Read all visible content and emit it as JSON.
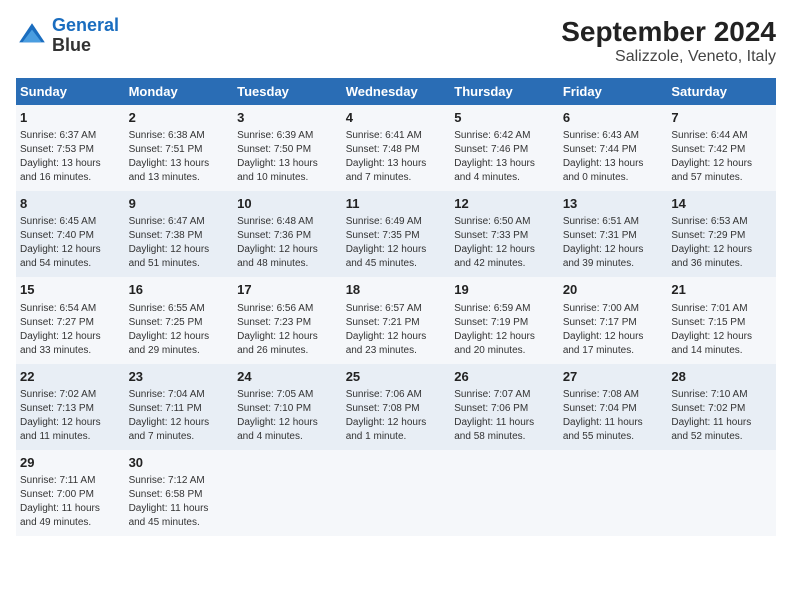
{
  "header": {
    "logo_line1": "General",
    "logo_line2": "Blue",
    "title": "September 2024",
    "subtitle": "Salizzole, Veneto, Italy"
  },
  "days_of_week": [
    "Sunday",
    "Monday",
    "Tuesday",
    "Wednesday",
    "Thursday",
    "Friday",
    "Saturday"
  ],
  "weeks": [
    [
      {
        "day": "1",
        "detail": "Sunrise: 6:37 AM\nSunset: 7:53 PM\nDaylight: 13 hours\nand 16 minutes."
      },
      {
        "day": "2",
        "detail": "Sunrise: 6:38 AM\nSunset: 7:51 PM\nDaylight: 13 hours\nand 13 minutes."
      },
      {
        "day": "3",
        "detail": "Sunrise: 6:39 AM\nSunset: 7:50 PM\nDaylight: 13 hours\nand 10 minutes."
      },
      {
        "day": "4",
        "detail": "Sunrise: 6:41 AM\nSunset: 7:48 PM\nDaylight: 13 hours\nand 7 minutes."
      },
      {
        "day": "5",
        "detail": "Sunrise: 6:42 AM\nSunset: 7:46 PM\nDaylight: 13 hours\nand 4 minutes."
      },
      {
        "day": "6",
        "detail": "Sunrise: 6:43 AM\nSunset: 7:44 PM\nDaylight: 13 hours\nand 0 minutes."
      },
      {
        "day": "7",
        "detail": "Sunrise: 6:44 AM\nSunset: 7:42 PM\nDaylight: 12 hours\nand 57 minutes."
      }
    ],
    [
      {
        "day": "8",
        "detail": "Sunrise: 6:45 AM\nSunset: 7:40 PM\nDaylight: 12 hours\nand 54 minutes."
      },
      {
        "day": "9",
        "detail": "Sunrise: 6:47 AM\nSunset: 7:38 PM\nDaylight: 12 hours\nand 51 minutes."
      },
      {
        "day": "10",
        "detail": "Sunrise: 6:48 AM\nSunset: 7:36 PM\nDaylight: 12 hours\nand 48 minutes."
      },
      {
        "day": "11",
        "detail": "Sunrise: 6:49 AM\nSunset: 7:35 PM\nDaylight: 12 hours\nand 45 minutes."
      },
      {
        "day": "12",
        "detail": "Sunrise: 6:50 AM\nSunset: 7:33 PM\nDaylight: 12 hours\nand 42 minutes."
      },
      {
        "day": "13",
        "detail": "Sunrise: 6:51 AM\nSunset: 7:31 PM\nDaylight: 12 hours\nand 39 minutes."
      },
      {
        "day": "14",
        "detail": "Sunrise: 6:53 AM\nSunset: 7:29 PM\nDaylight: 12 hours\nand 36 minutes."
      }
    ],
    [
      {
        "day": "15",
        "detail": "Sunrise: 6:54 AM\nSunset: 7:27 PM\nDaylight: 12 hours\nand 33 minutes."
      },
      {
        "day": "16",
        "detail": "Sunrise: 6:55 AM\nSunset: 7:25 PM\nDaylight: 12 hours\nand 29 minutes."
      },
      {
        "day": "17",
        "detail": "Sunrise: 6:56 AM\nSunset: 7:23 PM\nDaylight: 12 hours\nand 26 minutes."
      },
      {
        "day": "18",
        "detail": "Sunrise: 6:57 AM\nSunset: 7:21 PM\nDaylight: 12 hours\nand 23 minutes."
      },
      {
        "day": "19",
        "detail": "Sunrise: 6:59 AM\nSunset: 7:19 PM\nDaylight: 12 hours\nand 20 minutes."
      },
      {
        "day": "20",
        "detail": "Sunrise: 7:00 AM\nSunset: 7:17 PM\nDaylight: 12 hours\nand 17 minutes."
      },
      {
        "day": "21",
        "detail": "Sunrise: 7:01 AM\nSunset: 7:15 PM\nDaylight: 12 hours\nand 14 minutes."
      }
    ],
    [
      {
        "day": "22",
        "detail": "Sunrise: 7:02 AM\nSunset: 7:13 PM\nDaylight: 12 hours\nand 11 minutes."
      },
      {
        "day": "23",
        "detail": "Sunrise: 7:04 AM\nSunset: 7:11 PM\nDaylight: 12 hours\nand 7 minutes."
      },
      {
        "day": "24",
        "detail": "Sunrise: 7:05 AM\nSunset: 7:10 PM\nDaylight: 12 hours\nand 4 minutes."
      },
      {
        "day": "25",
        "detail": "Sunrise: 7:06 AM\nSunset: 7:08 PM\nDaylight: 12 hours\nand 1 minute."
      },
      {
        "day": "26",
        "detail": "Sunrise: 7:07 AM\nSunset: 7:06 PM\nDaylight: 11 hours\nand 58 minutes."
      },
      {
        "day": "27",
        "detail": "Sunrise: 7:08 AM\nSunset: 7:04 PM\nDaylight: 11 hours\nand 55 minutes."
      },
      {
        "day": "28",
        "detail": "Sunrise: 7:10 AM\nSunset: 7:02 PM\nDaylight: 11 hours\nand 52 minutes."
      }
    ],
    [
      {
        "day": "29",
        "detail": "Sunrise: 7:11 AM\nSunset: 7:00 PM\nDaylight: 11 hours\nand 49 minutes."
      },
      {
        "day": "30",
        "detail": "Sunrise: 7:12 AM\nSunset: 6:58 PM\nDaylight: 11 hours\nand 45 minutes."
      },
      {
        "day": "",
        "detail": ""
      },
      {
        "day": "",
        "detail": ""
      },
      {
        "day": "",
        "detail": ""
      },
      {
        "day": "",
        "detail": ""
      },
      {
        "day": "",
        "detail": ""
      }
    ]
  ]
}
